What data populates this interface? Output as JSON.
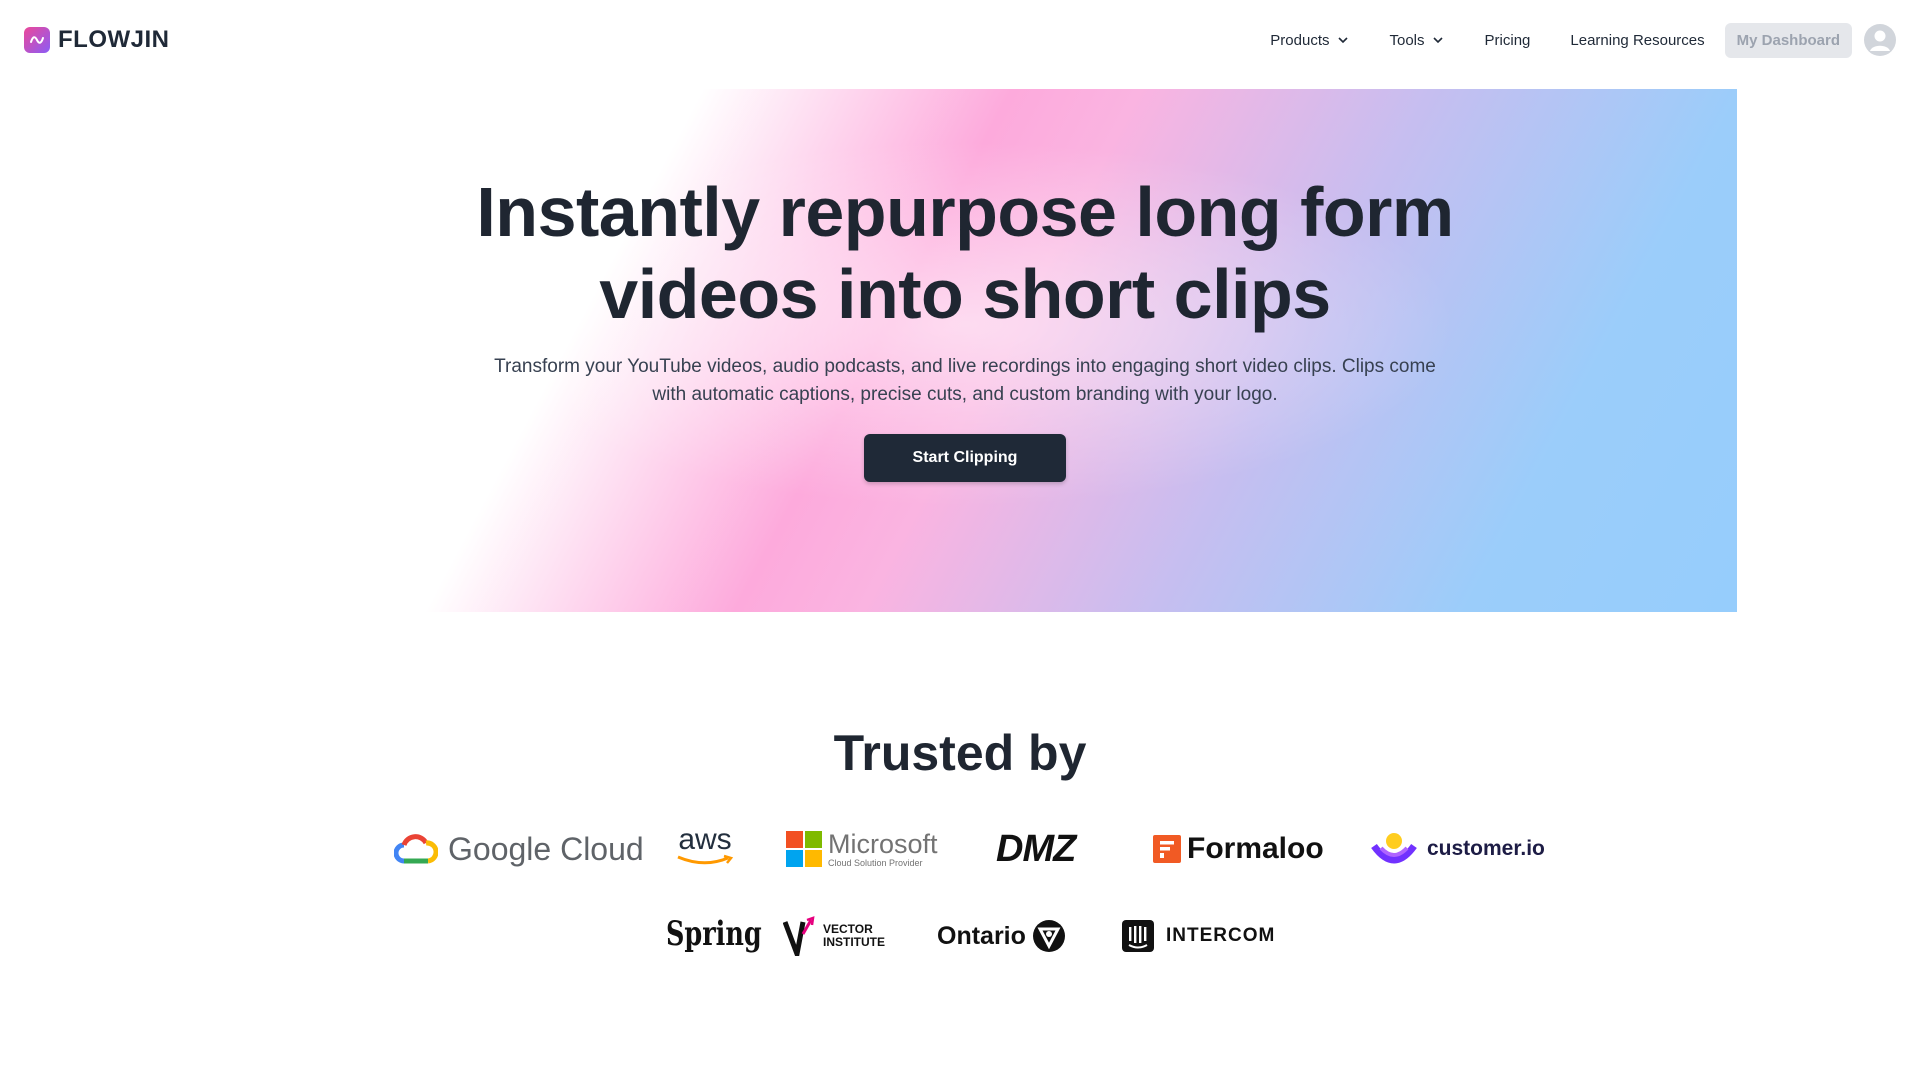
{
  "brand": {
    "name": "FLOWJIN",
    "icon": "wave-logo-icon",
    "color": "#a855f7"
  },
  "nav": {
    "items": [
      {
        "label": "Products",
        "has_dropdown": true
      },
      {
        "label": "Tools",
        "has_dropdown": true
      },
      {
        "label": "Pricing",
        "has_dropdown": false
      },
      {
        "label": "Learning Resources",
        "has_dropdown": false
      }
    ],
    "dashboard_label": "My Dashboard",
    "avatar_icon": "user-avatar-icon"
  },
  "hero": {
    "title_line1": "Instantly repurpose long form",
    "title_line2": "videos into short clips",
    "subtitle": "Transform your YouTube videos, audio podcasts, and live recordings into engaging short video clips. Clips come with automatic captions, precise cuts, and custom branding with your logo.",
    "cta_label": "Start Clipping"
  },
  "trusted": {
    "title": "Trusted by",
    "logos": {
      "google_cloud": "Google Cloud",
      "aws": "aws",
      "microsoft": "Microsoft",
      "microsoft_sub": "Cloud Solution Provider",
      "dmz": "DMZ",
      "formaloo": "Formaloo",
      "customerio": "customer.io",
      "spring": "Spring",
      "vector_line1": "VECTOR",
      "vector_line2": "INSTITUTE",
      "ontario": "Ontario",
      "intercom": "INTERCOM"
    }
  }
}
